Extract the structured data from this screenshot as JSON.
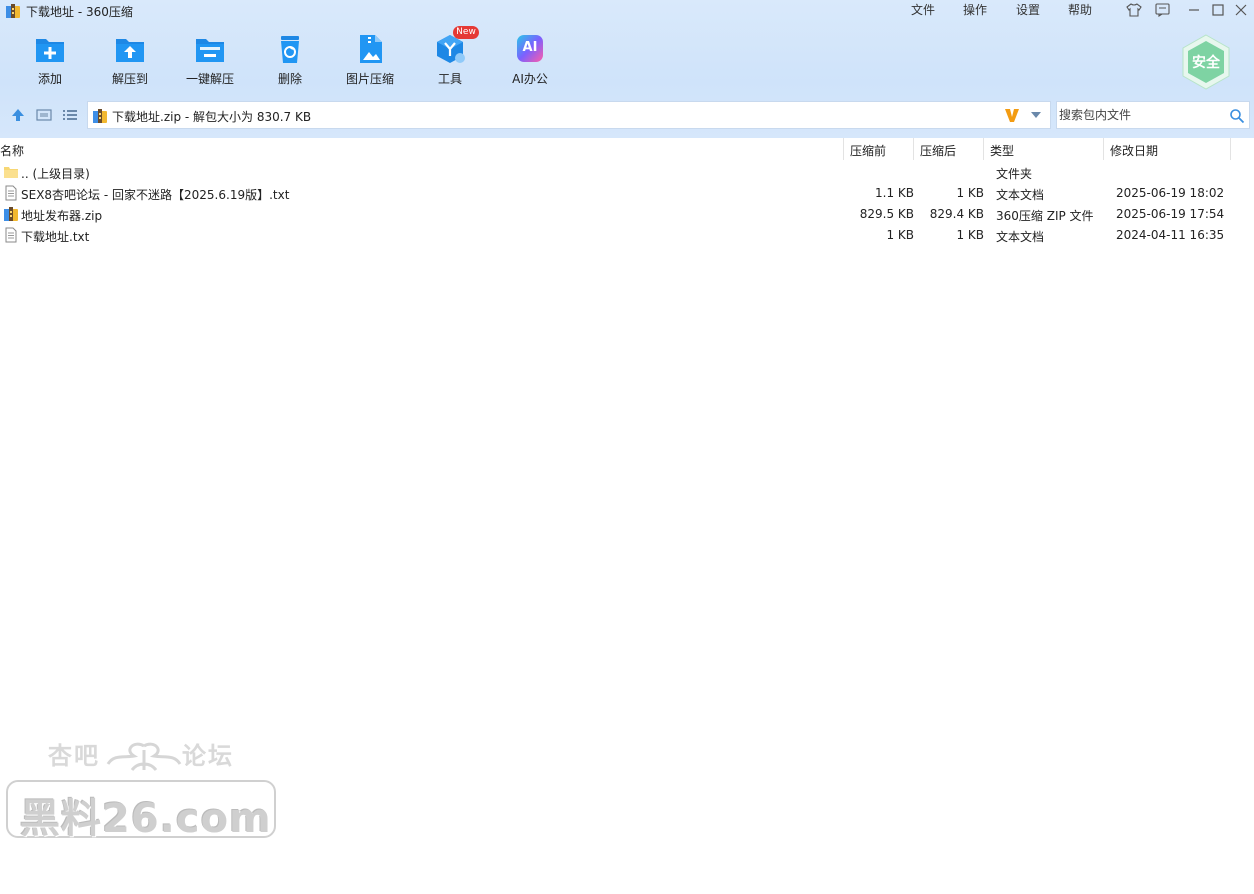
{
  "window": {
    "title": "下载地址 - 360压缩",
    "menu": [
      "文件",
      "操作",
      "设置",
      "帮助"
    ]
  },
  "toolbar": {
    "items": [
      {
        "label": "添加",
        "icon": "add-icon"
      },
      {
        "label": "解压到",
        "icon": "extract-to-icon"
      },
      {
        "label": "一键解压",
        "icon": "one-click-extract-icon"
      },
      {
        "label": "删除",
        "icon": "delete-icon"
      },
      {
        "label": "图片压缩",
        "icon": "image-compress-icon"
      },
      {
        "label": "工具",
        "icon": "tools-icon"
      },
      {
        "label": "AI办公",
        "icon": "ai-office-icon"
      }
    ],
    "new_badge": "New",
    "safe_label": "安全",
    "ai_glyph": "AI"
  },
  "nav": {
    "path": "下载地址.zip - 解包大小为 830.7 KB",
    "search_placeholder": "搜索包内文件"
  },
  "table": {
    "headers": {
      "name": "名称",
      "before": "压缩前",
      "after": "压缩后",
      "type": "类型",
      "modified": "修改日期"
    },
    "rows": [
      {
        "name": ".. (上级目录)",
        "before": "",
        "after": "",
        "type": "文件夹",
        "modified": "",
        "icon": "folder-icon"
      },
      {
        "name": "SEX8杏吧论坛 - 回家不迷路【2025.6.19版】.txt",
        "before": "1.1 KB",
        "after": "1 KB",
        "type": "文本文档",
        "modified": "2025-06-19 18:02",
        "icon": "text-file-icon"
      },
      {
        "name": "地址发布器.zip",
        "before": "829.5 KB",
        "after": "829.4 KB",
        "type": "360压缩 ZIP 文件",
        "modified": "2025-06-19 17:54",
        "icon": "zip-file-icon"
      },
      {
        "name": "下载地址.txt",
        "before": "1 KB",
        "after": "1 KB",
        "type": "文本文档",
        "modified": "2024-04-11 16:35",
        "icon": "text-file-icon"
      }
    ]
  },
  "watermark": {
    "top_left": "杏吧",
    "top_right": "论坛",
    "main": "黑料26.com"
  },
  "colors": {
    "accent": "#1e88e5",
    "toolbar_bg": "#d3e5fa",
    "safe_green": "#7ed3a3",
    "badge_red": "#e53935"
  }
}
